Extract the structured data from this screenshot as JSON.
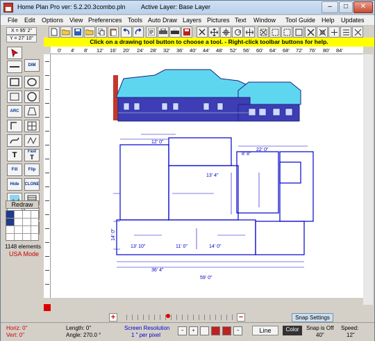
{
  "window": {
    "app_title": "Home Plan Pro ver: 5.2.20.3",
    "file_name": "combo.pln",
    "active_layer": "Active Layer: Base Layer",
    "minimize": "–",
    "maximize": "□",
    "close": "✕"
  },
  "menu": [
    "File",
    "Edit",
    "Options",
    "View",
    "Preferences",
    "Tools",
    "Auto Draw",
    "Layers",
    "Pictures",
    "Text",
    "Window",
    "Tool Guide",
    "Help",
    "Updates"
  ],
  "coords": {
    "x": "X = 95' 2\"",
    "y": "Y = 27' 10\""
  },
  "hint": "Click on a drawing tool button to choose a tool.  -  Right-click toolbar buttons for help.",
  "ruler_h": [
    "0'",
    "4'",
    "8'",
    "12'",
    "16'",
    "20'",
    "24'",
    "28'",
    "32'",
    "36'",
    "40'",
    "44'",
    "48'",
    "52'",
    "56'",
    "60'",
    "64'",
    "68'",
    "72'",
    "76'",
    "80'",
    "84'"
  ],
  "left_panel": {
    "dim_label": "DIM",
    "arc_label": "ARC",
    "fast_label": "Fast",
    "fill_label": "Fill",
    "flip_label": "Flip",
    "hide_label": "Hide",
    "clone_label": "CLONE",
    "redraw": "Redraw",
    "elements": "1148 elements",
    "mode": "USA Mode"
  },
  "plan": {
    "top_dim": "22' 0\"",
    "top_left": "12' 0\"",
    "dim_a": "8' 8\"",
    "dim_b": "13' 4\"",
    "dim_c": "13' 10\"",
    "dim_d": "11' 0\"",
    "dim_e": "14' 0\"",
    "dim_f": "36' 4\"",
    "dim_g": "59' 0\"",
    "side_dim": "14' 0\""
  },
  "nav": {
    "snap_settings": "Snap Settings"
  },
  "status": {
    "horiz": "Horiz: 0\"",
    "vert": "Vert: 0\"",
    "length": "Length: 0\"",
    "angle": "Angle: 270.0 °",
    "screen_res_label": "Screen Resolution",
    "screen_res_value": "1 \" per pixel",
    "line": "Line",
    "color": "Color",
    "snap_label": "Snap is Off",
    "snap_value": "40\"",
    "speed_label": "Speed:",
    "speed_value": "12\""
  },
  "colors": {
    "accent_blue": "#0000cc",
    "roof": "#5fd6f0",
    "wall": "#3d3db5",
    "chimney": "#c0392b",
    "hint_bg": "#ffff00",
    "status_red": "#cc0000"
  }
}
